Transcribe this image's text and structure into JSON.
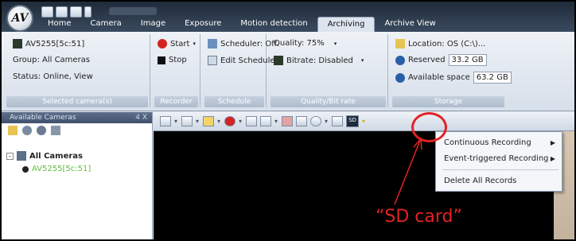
{
  "window": {
    "tabs": [
      "Home",
      "Camera",
      "Image",
      "Exposure",
      "Motion detection",
      "Archiving",
      "Archive View"
    ],
    "active_tab": "Archiving"
  },
  "ribbon": {
    "selected_camera": {
      "camera": "AV5255[5c:51]",
      "group": "Group: All Cameras",
      "status": "Status: Online, View",
      "label": "Selected camera(s)"
    },
    "recorder": {
      "start": "Start",
      "stop": "Stop",
      "label": "Recorder"
    },
    "schedule": {
      "scheduler": "Scheduler: Off",
      "edit": "Edit Schedule",
      "label": "Schedule"
    },
    "quality": {
      "quality": "Quality: 75%",
      "bitrate": "Bitrate: Disabled",
      "label": "Quality/Bit rate"
    },
    "storage": {
      "location": "Location: OS (C:\\)...",
      "reserved_label": "Reserved",
      "reserved_value": "33.2 GB",
      "available_label": "Available space",
      "available_value": "63.2 GB",
      "label": "Storage"
    }
  },
  "left_panel": {
    "header": "Available Cameras",
    "pin": "4 X",
    "tree": {
      "root": "All Cameras",
      "child": "AV5255[5c:51]"
    }
  },
  "toolbar": {
    "sd_button_text": "SD"
  },
  "dropdown": {
    "items": [
      "Continuous Recording",
      "Event-triggered Recording",
      "Delete All Records"
    ]
  },
  "annotation": {
    "label": "“SD card”",
    "color": "#e32222"
  }
}
